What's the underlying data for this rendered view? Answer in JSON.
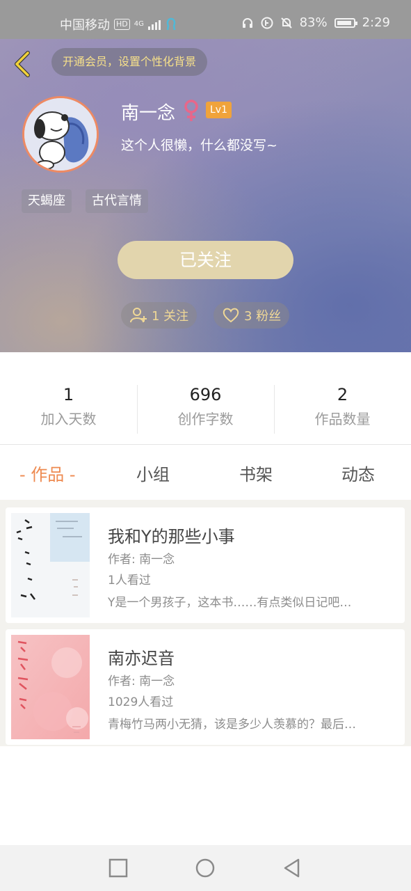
{
  "status_bar": {
    "carrier": "中国移动",
    "hd_badge": "HD",
    "network": "4G",
    "battery": "83%",
    "time": "2:29"
  },
  "header": {
    "vip_prompt": "开通会员，设置个性化背景",
    "username": "南一念",
    "level": "Lv1",
    "bio": "这个人很懒，什么都没写~",
    "tags": [
      "天蝎座",
      "古代言情"
    ],
    "follow_button": "已关注",
    "following": "1 关注",
    "fans": "3 粉丝"
  },
  "stats": [
    {
      "value": "1",
      "label": "加入天数"
    },
    {
      "value": "696",
      "label": "创作字数"
    },
    {
      "value": "2",
      "label": "作品数量"
    }
  ],
  "tabs": [
    "- 作品 -",
    "小组",
    "书架",
    "动态"
  ],
  "works": [
    {
      "title": "我和Y的那些小事",
      "author": "作者: 南一念",
      "views": "1人看过",
      "desc": "Y是一个男孩子，这本书……有点类似日记吧…"
    },
    {
      "title": "南亦迟音",
      "author": "作者: 南一念",
      "views": "1029人看过",
      "desc": "青梅竹马两小无猜，该是多少人羡慕的？最后…"
    }
  ],
  "colors": {
    "accent": "#ee8a50",
    "gold_text": "#f0d896",
    "follow_button": "#e2d5ad",
    "level_badge": "#f0a33b"
  }
}
